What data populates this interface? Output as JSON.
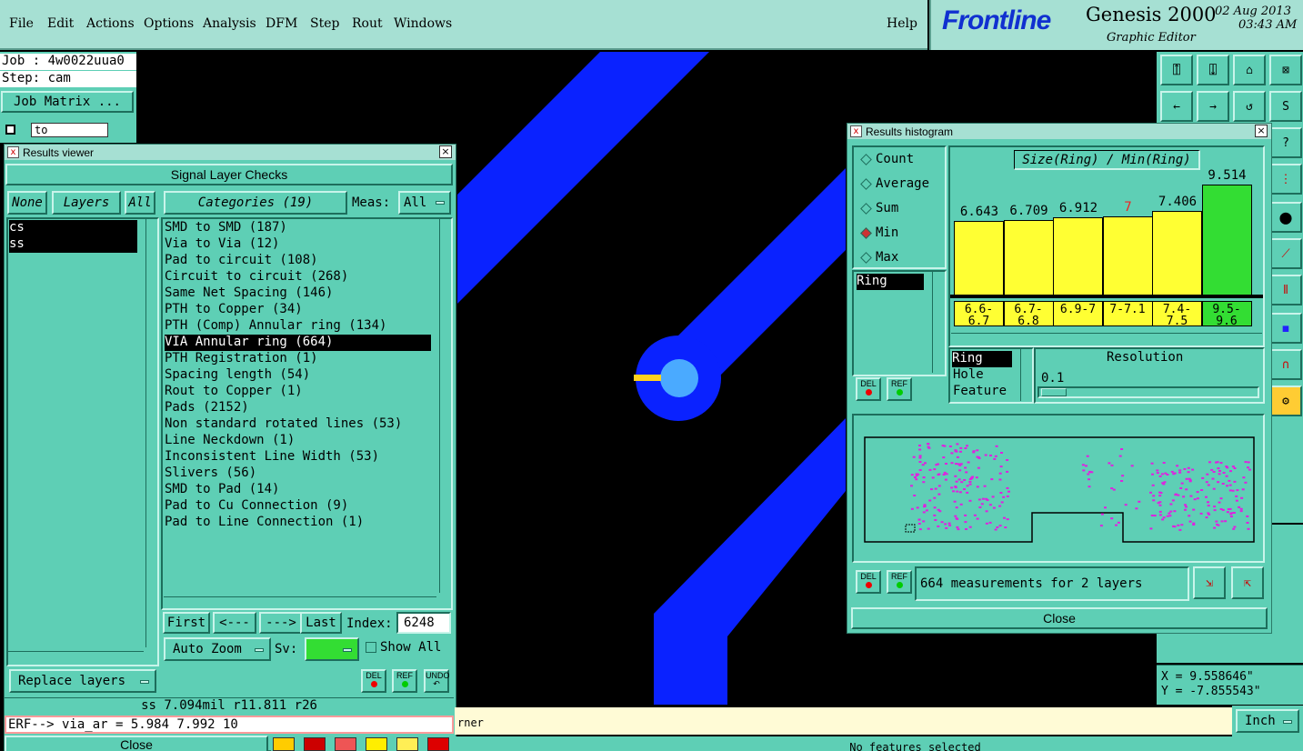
{
  "menubar": {
    "items": [
      "File",
      "Edit",
      "Actions",
      "Options",
      "Analysis",
      "DFM",
      "Step",
      "Rout",
      "Windows"
    ],
    "help": "Help"
  },
  "brand": {
    "logo": "Frontline",
    "product": "Genesis 2000",
    "subtitle": "Graphic Editor",
    "date": "02 Aug 2013",
    "time": "03:43 AM"
  },
  "left_panel": {
    "job": "Job : 4w0022uua0",
    "step": "Step: cam",
    "job_matrix": "Job Matrix ...",
    "to_field": "to"
  },
  "results_viewer": {
    "title": "Results viewer",
    "header": "Signal Layer Checks",
    "none_btn": "None",
    "layers_btn": "Layers",
    "all_btn": "All",
    "categories_btn": "Categories (19)",
    "meas_label": "Meas:",
    "meas_value": "All",
    "layers": [
      "cs",
      "ss"
    ],
    "categories": [
      "SMD to SMD (187)",
      "Via to Via (12)",
      "Pad to circuit (108)",
      "Circuit to circuit (268)",
      "Same Net Spacing (146)",
      "PTH to Copper (34)",
      "PTH (Comp) Annular ring (134)",
      "VIA Annular ring (664)",
      "PTH Registration (1)",
      "Spacing length (54)",
      "Rout to Copper (1)",
      "Pads (2152)",
      "Non standard rotated lines (53)",
      "Line Neckdown (1)",
      "Inconsistent Line Width (53)",
      "Slivers (56)",
      "SMD to Pad (14)",
      "Pad to Cu Connection (9)",
      "Pad to Line Connection (1)"
    ],
    "selected_category": 7,
    "first_btn": "First",
    "prev_btn": "<---",
    "next_btn": "--->",
    "last_btn": "Last",
    "index_label": "Index:",
    "index_value": "6248",
    "auto_zoom": "Auto Zoom",
    "sv_label": "Sv:",
    "show_all": "Show All",
    "replace_layers": "Replace layers",
    "del_label": "DEL",
    "ref_label": "REF",
    "undo_label": "UNDO",
    "status_line": "ss 7.094mil  r11.811  r26",
    "erf_line": "ERF--> via_ar = 5.984 7.992 10",
    "close_btn": "Close"
  },
  "histogram": {
    "title": "Results histogram",
    "modes": [
      "Count",
      "Average",
      "Sum",
      "Min",
      "Max"
    ],
    "selected_mode": "Min",
    "chart_title": "Size(Ring) / Min(Ring)",
    "list_items": [
      "Ring"
    ],
    "ranges": [
      "6.6-6.7",
      "6.7-6.8",
      "6.9-7",
      "7-7.1",
      "7.4-7.5",
      "9.5-9.6"
    ],
    "values": [
      6.643,
      6.709,
      6.912,
      7,
      7.406,
      9.514
    ],
    "value_labels": [
      "6.643",
      "6.709",
      "6.912",
      "7",
      "7.406",
      "9.514"
    ],
    "bar_color": "#ffff33",
    "highlight_color": "#33dd33",
    "attr_items": [
      "Ring",
      "Hole",
      "Feature"
    ],
    "resolution_label": "Resolution",
    "resolution_value": "0.1",
    "measurements": "664 measurements for 2 layers",
    "close_btn": "Close",
    "del_label": "DEL",
    "ref_label": "REF"
  },
  "chart_data": {
    "type": "bar",
    "title": "Size(Ring) / Min(Ring)",
    "categories": [
      "6.6-6.7",
      "6.7-6.8",
      "6.9-7",
      "7-7.1",
      "7.4-7.5",
      "9.5-9.6"
    ],
    "values": [
      6.643,
      6.709,
      6.912,
      7,
      7.406,
      9.514
    ]
  },
  "coords": {
    "x": "X = 9.558646\"",
    "y": "Y = -7.855543\""
  },
  "bottom": {
    "message": "rner",
    "units": "Inch",
    "status": "No features selected"
  },
  "colors": {
    "trace": "#0a22ff",
    "pad_center": "#4aaaff",
    "marker": "#ffd21f",
    "panel": "#5ecfb5",
    "menubar": "#a6e0d3"
  }
}
